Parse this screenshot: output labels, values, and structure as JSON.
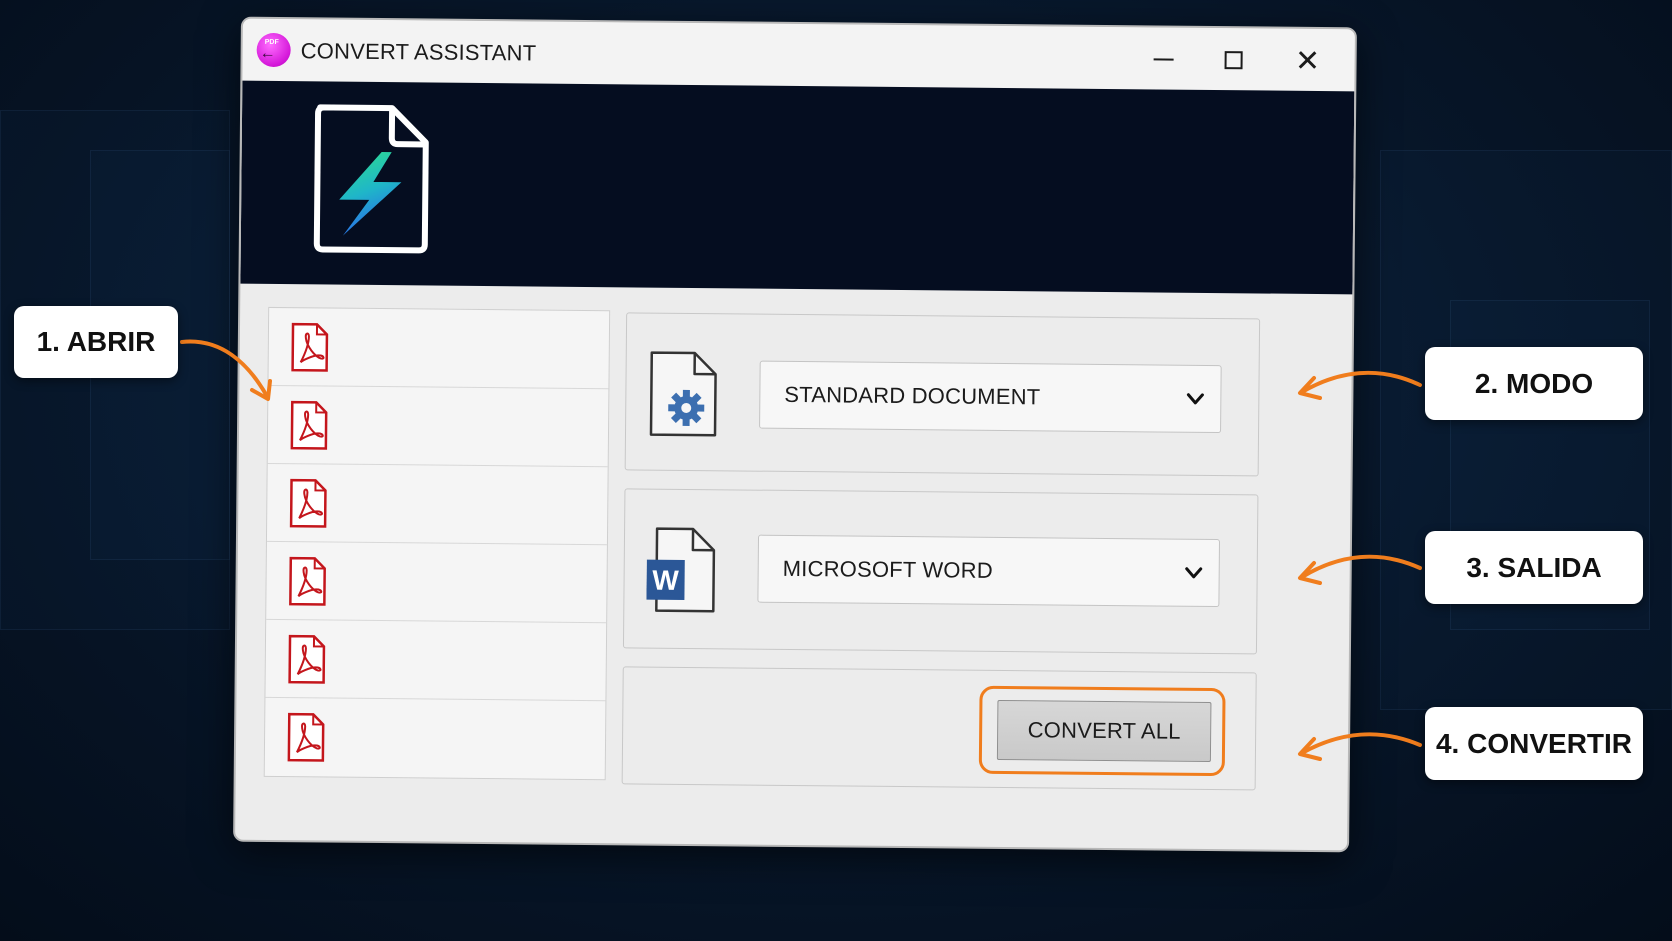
{
  "window": {
    "title": "CONVERT ASSISTANT",
    "logo_tag": "PDF",
    "controls": {
      "minimize_icon": "minimize-icon",
      "maximize_icon": "maximize-icon",
      "close_label": "✕"
    }
  },
  "banner": {
    "icon": "pdf-lightning-file-icon"
  },
  "file_list": {
    "items": [
      {
        "icon": "pdf-file-icon"
      },
      {
        "icon": "pdf-file-icon"
      },
      {
        "icon": "pdf-file-icon"
      },
      {
        "icon": "pdf-file-icon"
      },
      {
        "icon": "pdf-file-icon"
      },
      {
        "icon": "pdf-file-icon"
      }
    ]
  },
  "mode": {
    "icon": "settings-document-icon",
    "selected": "STANDARD DOCUMENT"
  },
  "output": {
    "icon": "word-document-icon",
    "icon_letter": "W",
    "selected": "MICROSOFT WORD"
  },
  "convert": {
    "label": "CONVERT ALL"
  },
  "callouts": {
    "open": "1. ABRIR",
    "mode": "2. MODO",
    "output": "3. SALIDA",
    "convert": "4. CONVERTIR"
  },
  "colors": {
    "accent_orange": "#f07d1d",
    "banner_bg": "#050d20",
    "pdf_red": "#c4161c",
    "word_blue": "#2b5797",
    "background": "#071629"
  }
}
